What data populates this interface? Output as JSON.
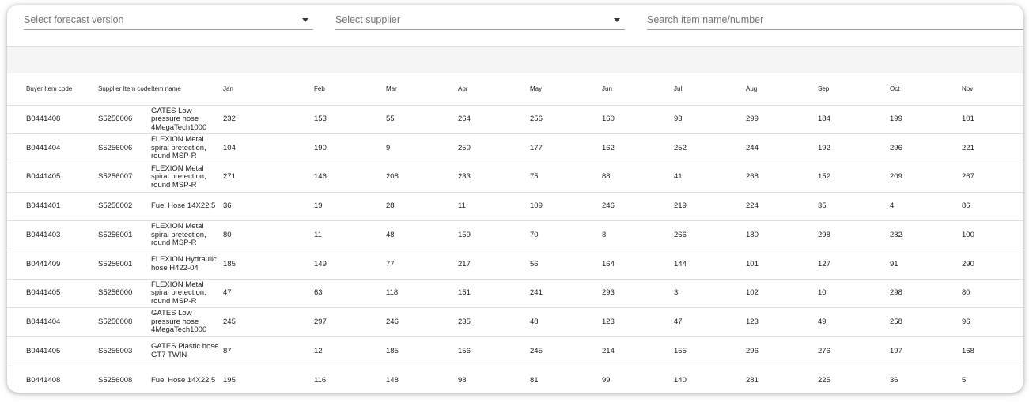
{
  "filters": {
    "forecast_placeholder": "Select forecast version",
    "supplier_placeholder": "Select supplier",
    "search_placeholder": "Search item name/number"
  },
  "table": {
    "headers": [
      "Buyer Item code",
      "Supplier Item code",
      "Item name",
      "Jan",
      "Feb",
      "Mar",
      "Apr",
      "May",
      "Jun",
      "Jul",
      "Aug",
      "Sep",
      "Oct",
      "Nov"
    ],
    "rows": [
      [
        "B0441408",
        "S5256006",
        "GATES Low pressure hose 4MegaTech1000",
        "232",
        "153",
        "55",
        "264",
        "256",
        "160",
        "93",
        "299",
        "184",
        "199",
        "101"
      ],
      [
        "B0441404",
        "S5256006",
        "FLEXION Metal spiral pretection, round MSP-R",
        "104",
        "190",
        "9",
        "250",
        "177",
        "162",
        "252",
        "244",
        "192",
        "296",
        "221"
      ],
      [
        "B0441405",
        "S5256007",
        "FLEXION Metal spiral pretection, round MSP-R",
        "271",
        "146",
        "208",
        "233",
        "75",
        "88",
        "41",
        "268",
        "152",
        "209",
        "267"
      ],
      [
        "B0441401",
        "S5256002",
        "Fuel Hose 14X22,5",
        "36",
        "19",
        "28",
        "11",
        "109",
        "246",
        "219",
        "224",
        "35",
        "4",
        "86"
      ],
      [
        "B0441403",
        "S5256001",
        "FLEXION Metal spiral pretection, round MSP-R",
        "80",
        "11",
        "48",
        "159",
        "70",
        "8",
        "266",
        "180",
        "298",
        "282",
        "100"
      ],
      [
        "B0441409",
        "S5256001",
        "FLEXION Hydraulic hose H422-04",
        "185",
        "149",
        "77",
        "217",
        "56",
        "164",
        "144",
        "101",
        "127",
        "91",
        "290"
      ],
      [
        "B0441405",
        "S5256000",
        "FLEXION Metal spiral pretection, round MSP-R",
        "47",
        "63",
        "118",
        "151",
        "241",
        "293",
        "3",
        "102",
        "10",
        "298",
        "80"
      ],
      [
        "B0441404",
        "S5256008",
        "GATES Low pressure hose 4MegaTech1000",
        "245",
        "297",
        "246",
        "235",
        "48",
        "123",
        "47",
        "123",
        "49",
        "258",
        "96"
      ],
      [
        "B0441405",
        "S5256003",
        "GATES Plastic hose GT7 TWIN",
        "87",
        "12",
        "185",
        "156",
        "245",
        "214",
        "155",
        "296",
        "276",
        "197",
        "168"
      ],
      [
        "B0441408",
        "S5256008",
        "Fuel Hose 14X22,5",
        "195",
        "116",
        "148",
        "98",
        "81",
        "99",
        "140",
        "281",
        "225",
        "36",
        "5"
      ]
    ]
  }
}
